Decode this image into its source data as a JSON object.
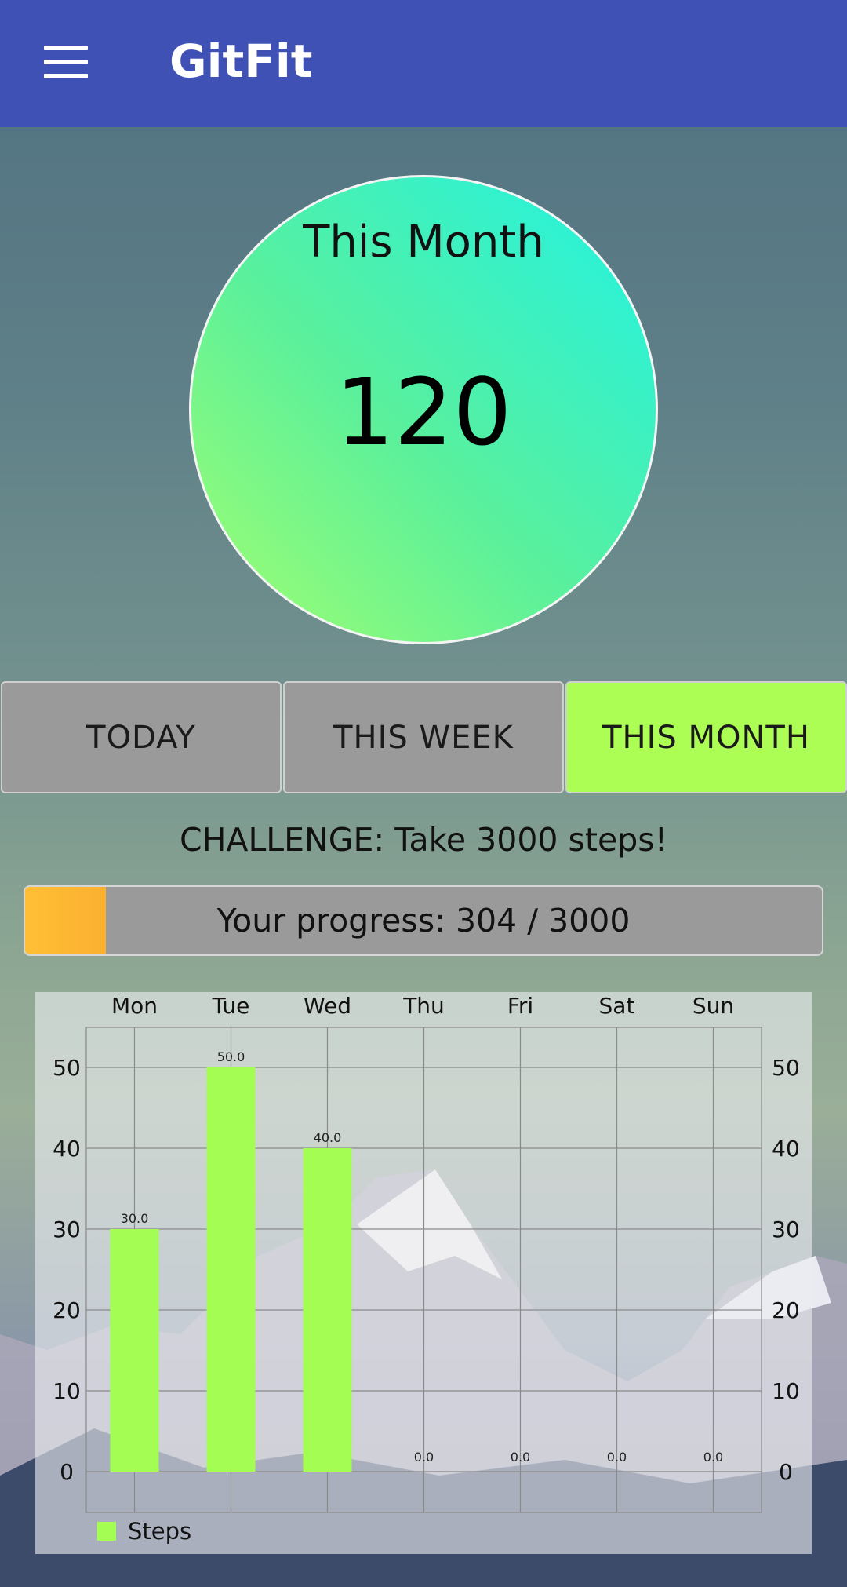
{
  "app": {
    "title": "GitFit"
  },
  "summary": {
    "label": "This Month",
    "value": "120"
  },
  "tabs": [
    {
      "label": "TODAY",
      "active": false
    },
    {
      "label": "THIS WEEK",
      "active": false
    },
    {
      "label": "THIS MONTH",
      "active": true
    }
  ],
  "challenge": {
    "text": "CHALLENGE: Take 3000 steps!"
  },
  "progress": {
    "text": "Your progress: 304 / 3000",
    "current": 304,
    "goal": 3000,
    "fill_color": "#fbb030"
  },
  "colors": {
    "appbar": "#3f51b5",
    "active_tab": "#adfe54",
    "bar": "#a4fd52"
  },
  "chart_data": {
    "type": "bar",
    "categories": [
      "Mon",
      "Tue",
      "Wed",
      "Thu",
      "Fri",
      "Sat",
      "Sun"
    ],
    "series": [
      {
        "name": "Steps",
        "values": [
          30.0,
          50.0,
          40.0,
          0.0,
          0.0,
          0.0,
          0.0
        ]
      }
    ],
    "value_labels": [
      "30.0",
      "50.0",
      "40.0",
      "0.0",
      "0.0",
      "0.0",
      "0.0"
    ],
    "yticks": [
      0,
      10,
      20,
      30,
      40,
      50
    ],
    "ylim": [
      0,
      55
    ],
    "x_axis_position": "top",
    "y_axis": "both sides",
    "grid": true,
    "legend": "bottom-left"
  }
}
